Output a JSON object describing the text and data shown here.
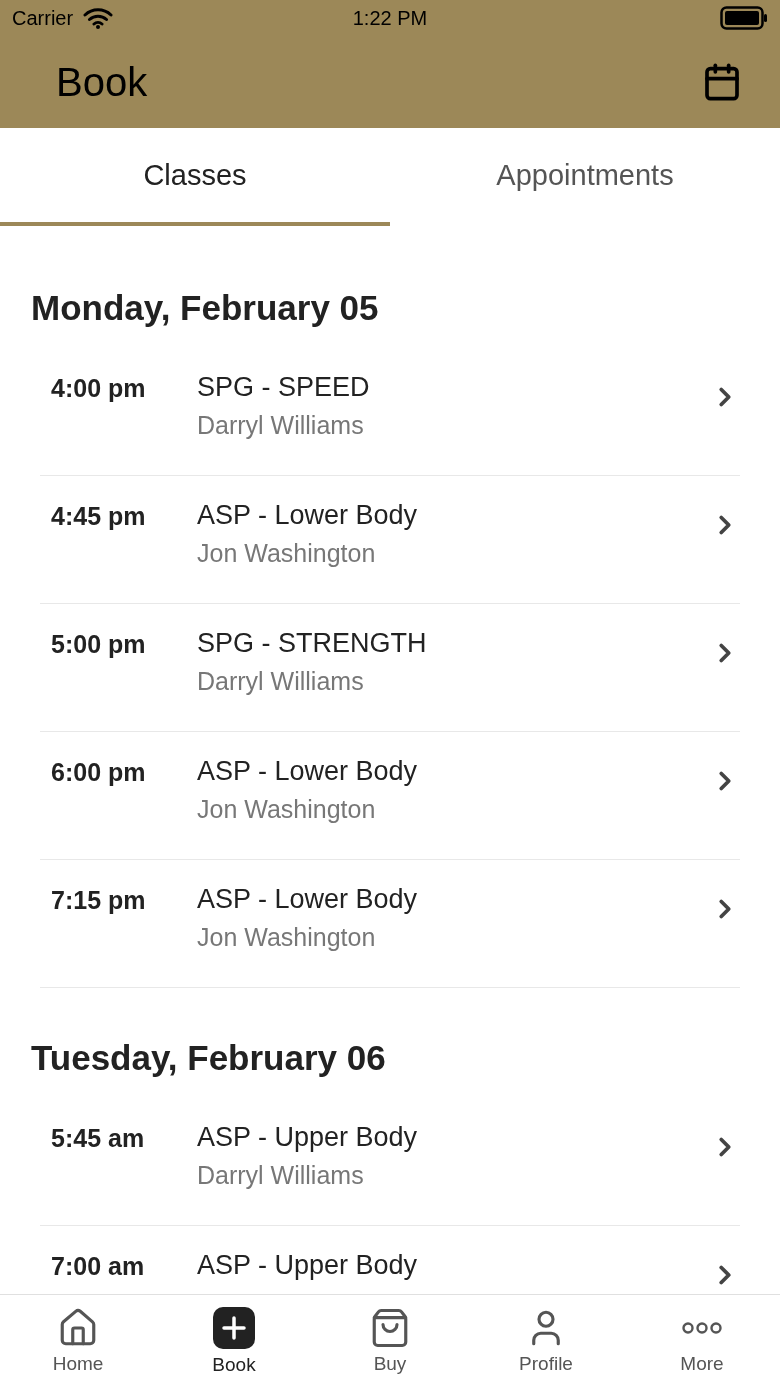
{
  "status_bar": {
    "carrier": "Carrier",
    "time": "1:22 PM"
  },
  "header": {
    "title": "Book"
  },
  "tabs": [
    {
      "label": "Classes",
      "selected": true
    },
    {
      "label": "Appointments",
      "selected": false
    }
  ],
  "days": [
    {
      "title": "Monday, February 05",
      "classes": [
        {
          "time": "4:00 pm",
          "name": "SPG - SPEED",
          "instructor": "Darryl Williams"
        },
        {
          "time": "4:45 pm",
          "name": "ASP - Lower Body",
          "instructor": "Jon Washington"
        },
        {
          "time": "5:00 pm",
          "name": "SPG - STRENGTH",
          "instructor": "Darryl Williams"
        },
        {
          "time": "6:00 pm",
          "name": "ASP - Lower Body",
          "instructor": "Jon Washington"
        },
        {
          "time": "7:15 pm",
          "name": "ASP - Lower Body",
          "instructor": "Jon Washington"
        }
      ]
    },
    {
      "title": "Tuesday, February 06",
      "classes": [
        {
          "time": "5:45 am",
          "name": "ASP - Upper Body",
          "instructor": "Darryl Williams"
        },
        {
          "time": "7:00 am",
          "name": "ASP - Upper Body"
        }
      ]
    }
  ],
  "nav": [
    {
      "kind": "home",
      "label": "Home",
      "selected": false
    },
    {
      "kind": "book",
      "label": "Book",
      "selected": true
    },
    {
      "kind": "buy",
      "label": "Buy",
      "selected": false
    },
    {
      "kind": "profile",
      "label": "Profile",
      "selected": false
    },
    {
      "kind": "more",
      "label": "More",
      "selected": false
    }
  ]
}
